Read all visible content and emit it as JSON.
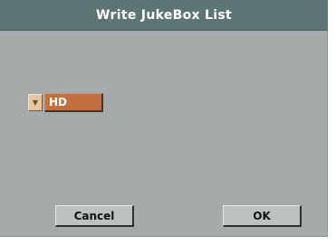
{
  "dialog": {
    "title": "Write JukeBox List"
  },
  "destination": {
    "icon": "chevron-down-icon",
    "selected_value": "HD"
  },
  "buttons": {
    "cancel_label": "Cancel",
    "ok_label": "OK"
  },
  "colors": {
    "titlebar": "#5d7675",
    "dialog_background": "#a4abaa",
    "selector_accent": "#c0713f",
    "button_face": "#bcc2c1"
  }
}
